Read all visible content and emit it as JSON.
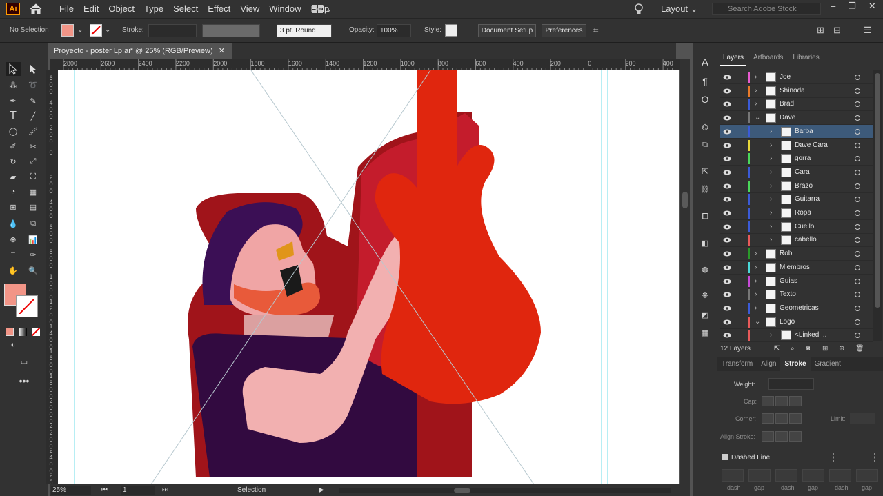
{
  "app": {
    "logo": "Ai",
    "menus": [
      "File",
      "Edit",
      "Object",
      "Type",
      "Select",
      "Effect",
      "View",
      "Window",
      "Help"
    ],
    "workspace": "Layout",
    "search_placeholder": "Search Adobe Stock"
  },
  "control": {
    "selection": "No Selection",
    "stroke_label": "Stroke:",
    "brush": "3 pt. Round",
    "opacity_label": "Opacity:",
    "opacity": "100%",
    "style_label": "Style:",
    "doc_setup": "Document Setup",
    "preferences": "Preferences",
    "fill_color": "#f29587"
  },
  "document": {
    "tab_title": "Proyecto - poster Lp.ai* @ 25% (RGB/Preview)"
  },
  "ruler": {
    "h": [
      "2800",
      "2600",
      "2400",
      "2200",
      "2000",
      "1800",
      "1600",
      "1400",
      "1200",
      "1000",
      "800",
      "600",
      "400",
      "200",
      "0",
      "200",
      "400"
    ],
    "v": [
      "600",
      "400",
      "200",
      "0",
      "200",
      "400",
      "600",
      "800",
      "1000",
      "1200",
      "1400",
      "1600",
      "1800",
      "2000",
      "2200",
      "2400",
      "2600"
    ]
  },
  "status": {
    "zoom": "25%",
    "artboard": "1",
    "mode": "Selection"
  },
  "panel": {
    "tabs": [
      "Layers",
      "Artboards",
      "Libraries"
    ],
    "layers": [
      {
        "name": "Joe",
        "color": "#e85bd0",
        "level": 0,
        "expanded": false
      },
      {
        "name": "Shinoda",
        "color": "#e87a2a",
        "level": 0,
        "expanded": false
      },
      {
        "name": "Brad",
        "color": "#3b5bd8",
        "level": 0,
        "expanded": false
      },
      {
        "name": "Dave",
        "color": "#777777",
        "level": 0,
        "expanded": true
      },
      {
        "name": "Barba",
        "color": "#3b5bd8",
        "level": 1,
        "expanded": false,
        "selected": true
      },
      {
        "name": "Dave Cara",
        "color": "#e8d83a",
        "level": 1,
        "expanded": false
      },
      {
        "name": "gorra",
        "color": "#4ad85a",
        "level": 1,
        "expanded": false
      },
      {
        "name": "Cara",
        "color": "#3b5bd8",
        "level": 1,
        "expanded": false
      },
      {
        "name": "Brazo",
        "color": "#4ad85a",
        "level": 1,
        "expanded": false
      },
      {
        "name": "Guitarra",
        "color": "#3b5bd8",
        "level": 1,
        "expanded": false
      },
      {
        "name": "Ropa",
        "color": "#3b5bd8",
        "level": 1,
        "expanded": false
      },
      {
        "name": "Cuello",
        "color": "#3b5bd8",
        "level": 1,
        "expanded": false
      },
      {
        "name": "cabello",
        "color": "#e85a5a",
        "level": 1,
        "expanded": false
      },
      {
        "name": "Rob",
        "color": "#2a9a2a",
        "level": 0,
        "expanded": false
      },
      {
        "name": "Miembros",
        "color": "#4ad8d8",
        "level": 0,
        "expanded": false
      },
      {
        "name": "Guias",
        "color": "#c84ad8",
        "level": 0,
        "expanded": false
      },
      {
        "name": "Texto",
        "color": "#777777",
        "level": 0,
        "expanded": false
      },
      {
        "name": "Geometricas",
        "color": "#3b5bd8",
        "level": 0,
        "expanded": false
      },
      {
        "name": "Logo",
        "color": "#e85a5a",
        "level": 0,
        "expanded": true
      },
      {
        "name": "<Linked ...",
        "color": "#e85a5a",
        "level": 1,
        "expanded": false
      }
    ],
    "layer_count": "12 Layers",
    "tabs2": [
      "Transform",
      "Align",
      "Stroke",
      "Gradient"
    ],
    "stroke": {
      "weight": "Weight:",
      "cap": "Cap:",
      "corner": "Corner:",
      "limit": "Limit:",
      "align": "Align Stroke:",
      "dashed": "Dashed Line",
      "dash_labels": [
        "dash",
        "gap",
        "dash",
        "gap",
        "dash",
        "gap"
      ]
    }
  }
}
